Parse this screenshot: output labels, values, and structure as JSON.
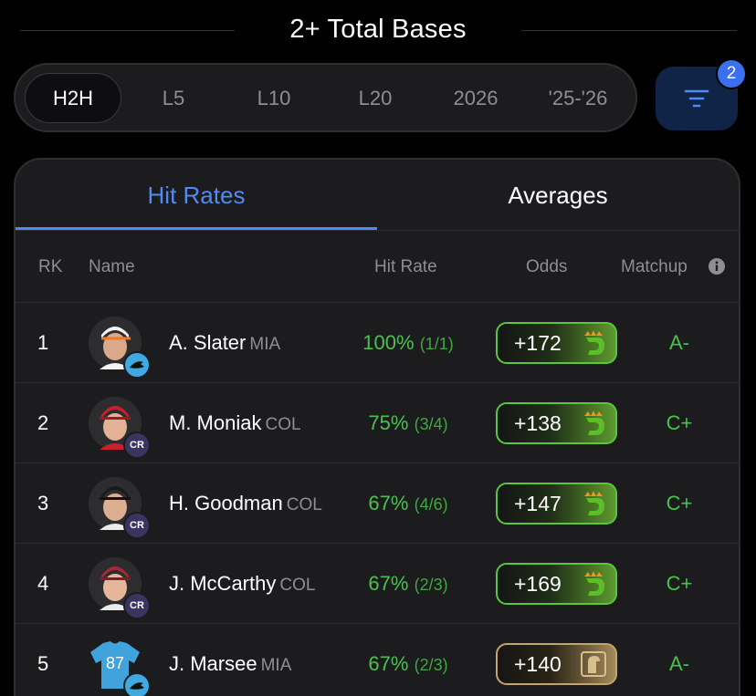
{
  "title": "2+ Total Bases",
  "periods": [
    "H2H",
    "L5",
    "L10",
    "L20",
    "2026",
    "'25-'26"
  ],
  "active_period": "H2H",
  "filter_badge": "2",
  "tabs": {
    "hit_rates": "Hit Rates",
    "averages": "Averages"
  },
  "columns": {
    "rk": "RK",
    "name": "Name",
    "hit_rate": "Hit Rate",
    "odds": "Odds",
    "matchup": "Matchup"
  },
  "rows": [
    {
      "rk": "1",
      "name": "A. Slater",
      "team": "MIA",
      "pct": "100%",
      "frac": "(1/1)",
      "odds": "+172",
      "book": "draftkings",
      "matchup": "A-"
    },
    {
      "rk": "2",
      "name": "M. Moniak",
      "team": "COL",
      "pct": "75%",
      "frac": "(3/4)",
      "odds": "+138",
      "book": "draftkings",
      "matchup": "C+"
    },
    {
      "rk": "3",
      "name": "H. Goodman",
      "team": "COL",
      "pct": "67%",
      "frac": "(4/6)",
      "odds": "+147",
      "book": "draftkings",
      "matchup": "C+"
    },
    {
      "rk": "4",
      "name": "J. McCarthy",
      "team": "COL",
      "pct": "67%",
      "frac": "(2/3)",
      "odds": "+169",
      "book": "draftkings",
      "matchup": "C+"
    },
    {
      "rk": "5",
      "name": "J. Marsee",
      "team": "MIA",
      "pct": "67%",
      "frac": "(2/3)",
      "odds": "+140",
      "book": "fanatics",
      "matchup": "A-",
      "jersey": "87"
    }
  ],
  "colors": {
    "accent": "#4f8bf0",
    "positive": "#4cc04c",
    "draftkings_border": "#5cc53e",
    "fanatics_border": "#c2a56b"
  },
  "icons": {
    "filter": "filter-icon",
    "info": "info-icon"
  }
}
